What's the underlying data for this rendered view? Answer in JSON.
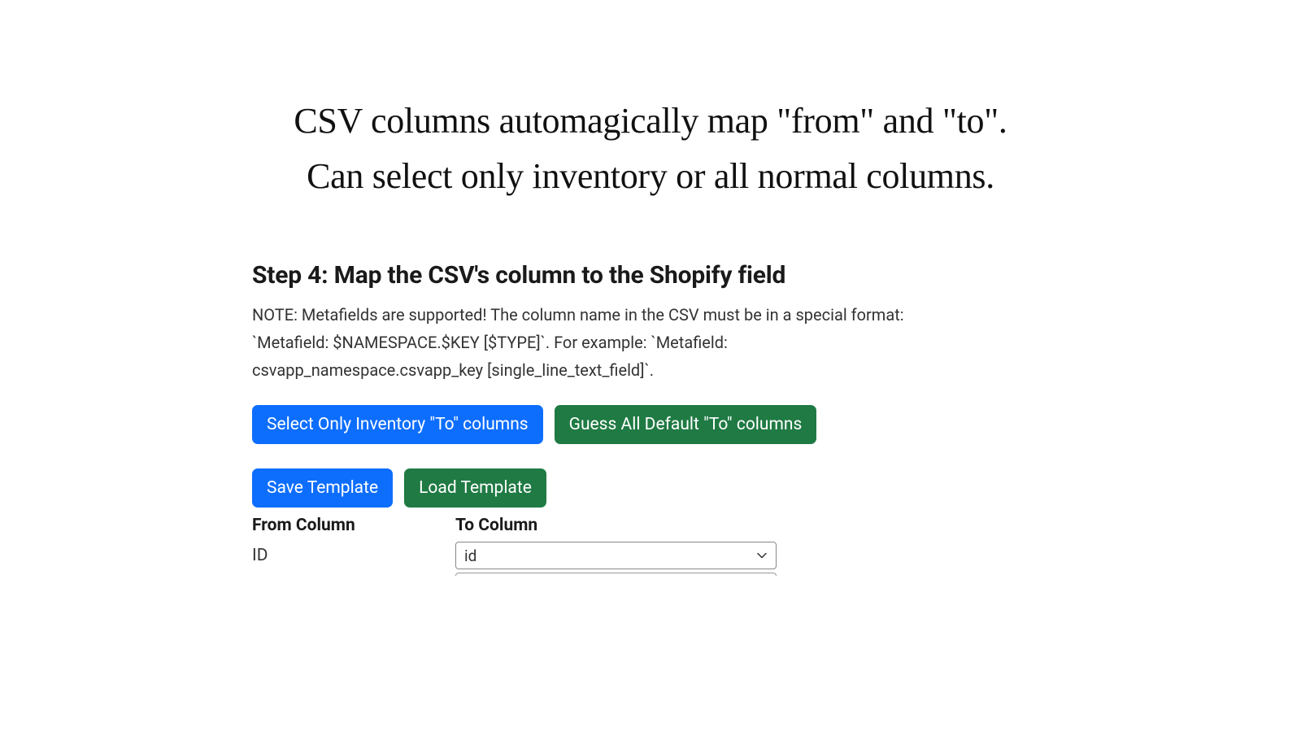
{
  "caption": {
    "line1": "CSV columns automagically map \"from\" and \"to\".",
    "line2": "Can select only inventory or all normal columns."
  },
  "step": {
    "heading": "Step 4: Map the CSV's column to the Shopify field",
    "note": "NOTE: Metafields are supported! The column name in the CSV must be in a special format: `Metafield: $NAMESPACE.$KEY [$TYPE]`. For example: `Metafield: csvapp_namespace.csvapp_key [single_line_text_field]`."
  },
  "buttons": {
    "select_inventory": "Select Only Inventory \"To\" columns",
    "guess_default": "Guess All Default \"To\" columns",
    "save_template": "Save Template",
    "load_template": "Load Template"
  },
  "table": {
    "from_header": "From Column",
    "to_header": "To Column",
    "rows": [
      {
        "from": "ID",
        "to": "id"
      }
    ]
  }
}
